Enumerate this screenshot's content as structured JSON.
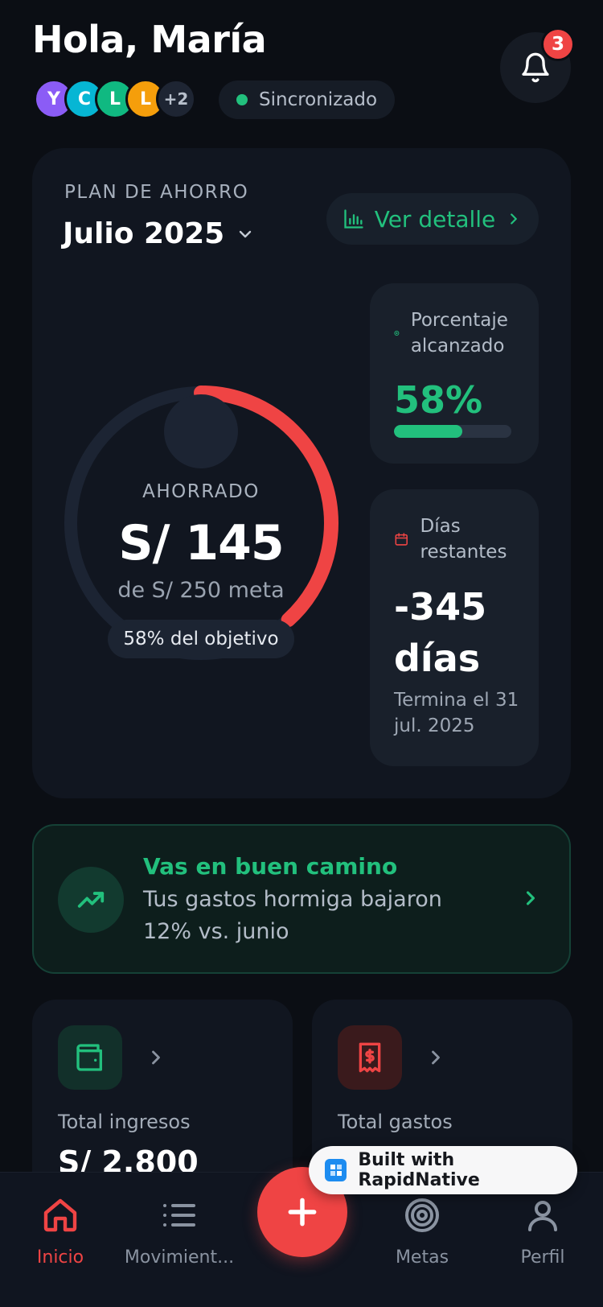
{
  "header": {
    "greeting": "Hola, María",
    "notifications_count": "3",
    "sync_status": "Sincronizado",
    "members": [
      {
        "initial": "Y",
        "color": "#8b5cf6"
      },
      {
        "initial": "C",
        "color": "#06b6d4"
      },
      {
        "initial": "L",
        "color": "#10b981"
      },
      {
        "initial": "L",
        "color": "#f59e0b"
      }
    ],
    "members_more": "+2"
  },
  "plan": {
    "label": "PLAN DE AHORRO",
    "month": "Julio 2025",
    "detail_button": "Ver detalle",
    "ring": {
      "label": "AHORRADO",
      "amount": "S/ 145",
      "goal": "de S/ 250 meta",
      "pill": "58% del objetivo",
      "progress": 0.58,
      "color": "#ef4444"
    },
    "percent_card": {
      "title": "Porcentaje alcanzado",
      "value": "58%",
      "progress": 0.58
    },
    "days_card": {
      "title": "Días restantes",
      "value": "-345 días",
      "subtitle": "Termina el 31 jul. 2025"
    }
  },
  "insight": {
    "title": "Vas en buen camino",
    "text": "Tus gastos hormiga bajaron 12% vs. junio"
  },
  "summary": {
    "income_label": "Total ingresos",
    "income_value": "S/ 2,800",
    "expense_label": "Total gastos"
  },
  "nav": {
    "home": "Inicio",
    "movements": "Movimient...",
    "goals": "Metas",
    "profile": "Perfil"
  },
  "badge": {
    "text": "Built with RapidNative"
  },
  "colors": {
    "accent_green": "#22c07d",
    "accent_red": "#ef4444",
    "background": "#0b0e14",
    "card": "#111620"
  }
}
